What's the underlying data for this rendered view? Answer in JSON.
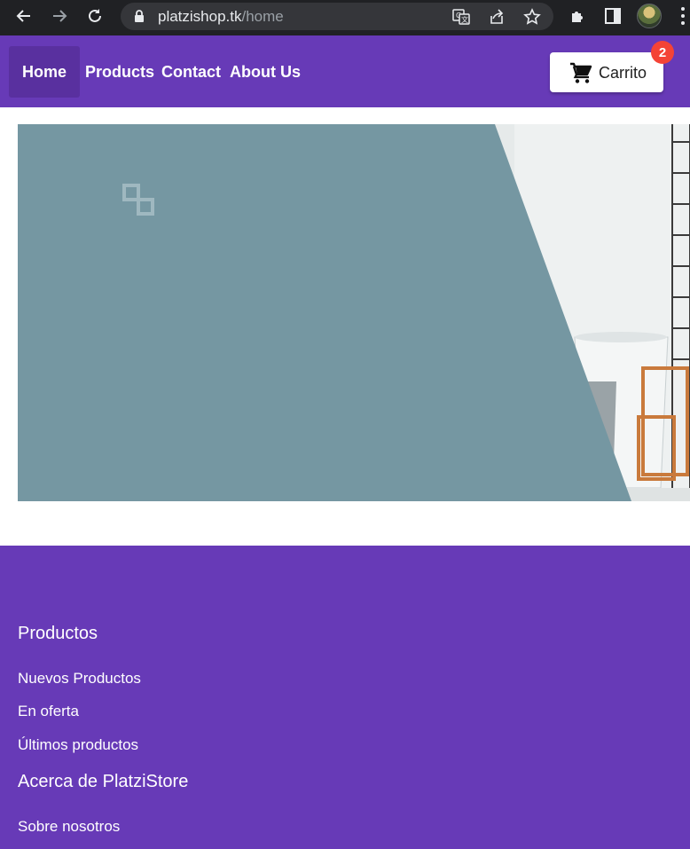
{
  "browser": {
    "url_domain": "platzishop.tk",
    "url_path": "/home",
    "icons": [
      "back-icon",
      "forward-icon",
      "reload-icon",
      "lock-icon",
      "translate-icon",
      "share-icon",
      "star-icon",
      "extensions-icon",
      "sidebar-icon",
      "profile-avatar",
      "menu-icon"
    ]
  },
  "nav": {
    "items": [
      {
        "label": "Home",
        "active": true
      },
      {
        "label": "Products",
        "active": false
      },
      {
        "label": "Contact",
        "active": false
      },
      {
        "label": "About Us",
        "active": false
      }
    ]
  },
  "cart": {
    "label": "Carrito",
    "count": "2",
    "icon": "shopping-cart-icon"
  },
  "hero": {
    "logo_icon": "platzi-store-logo-icon"
  },
  "footer": {
    "sections": [
      {
        "heading": "Productos",
        "links": [
          "Nuevos Productos",
          "En oferta",
          "Últimos productos"
        ]
      },
      {
        "heading": "Acerca de PlatziStore",
        "links": [
          "Sobre nosotros"
        ]
      }
    ]
  },
  "colors": {
    "primary": "#673ab7",
    "nav_active": "#59309f",
    "badge": "#f44336",
    "hero_panel": "#7597a2",
    "browser_chrome": "#202124"
  }
}
